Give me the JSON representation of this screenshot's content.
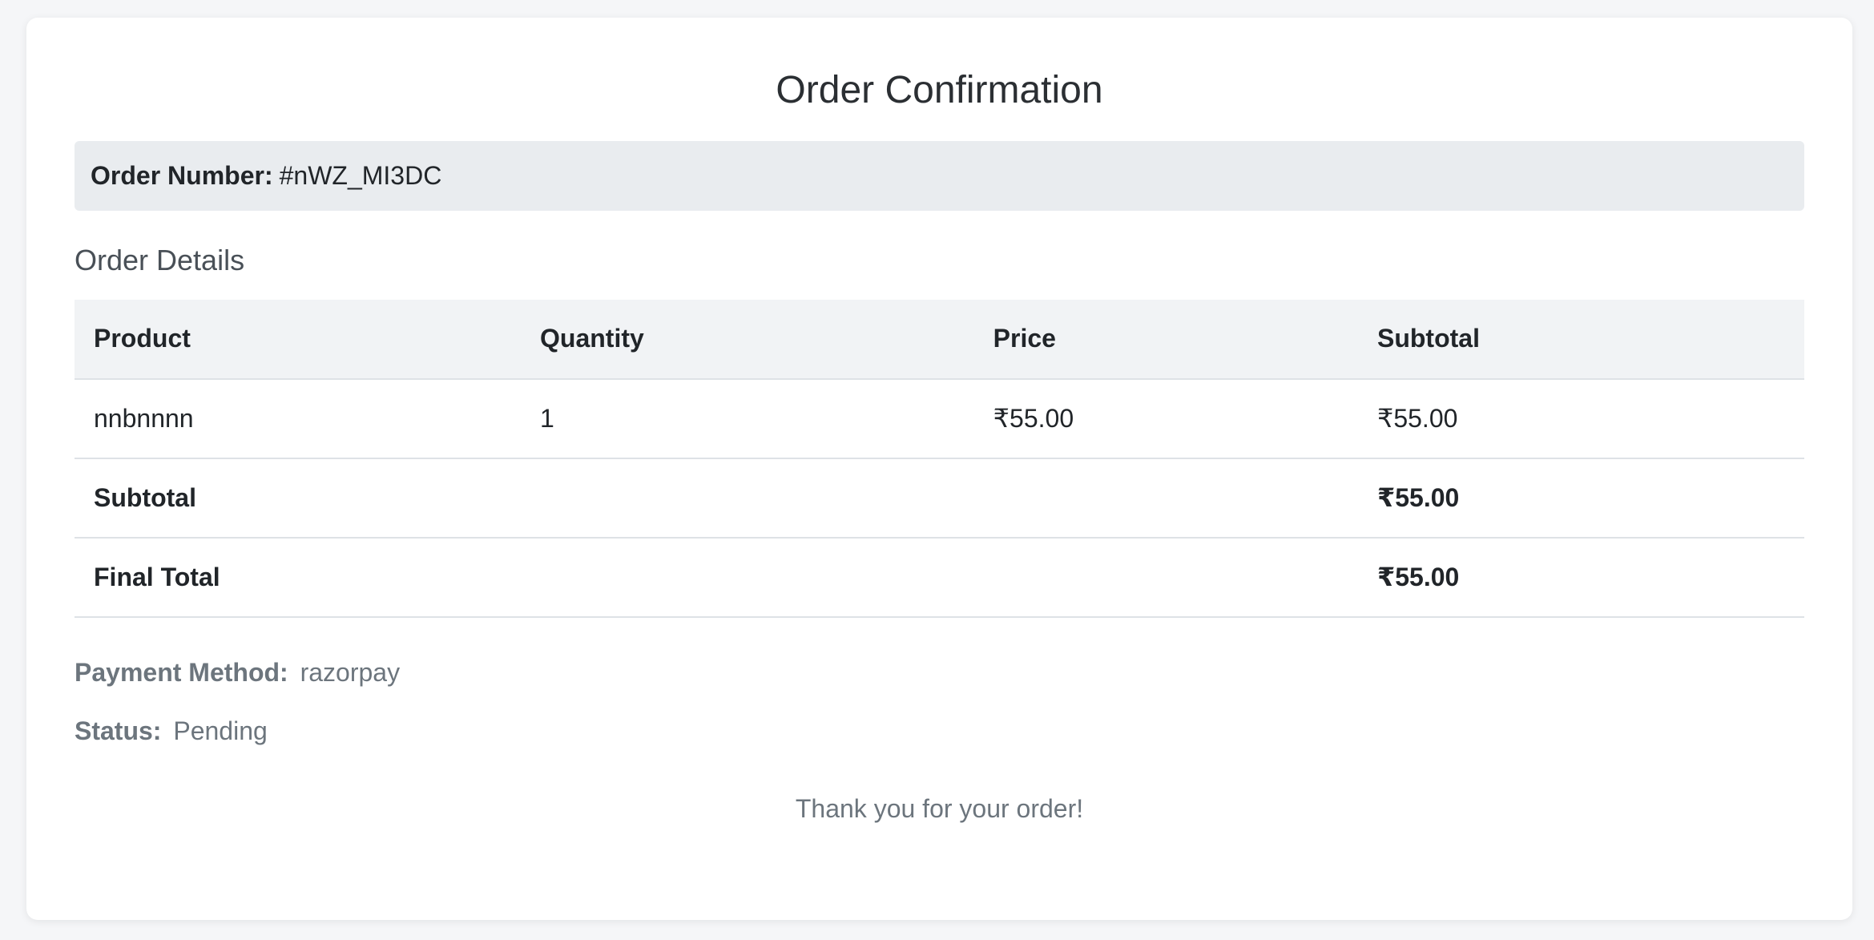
{
  "page": {
    "title": "Order Confirmation"
  },
  "order": {
    "number_label": "Order Number:",
    "number_value": "#nWZ_MI3DC"
  },
  "details": {
    "section_title": "Order Details",
    "columns": [
      "Product",
      "Quantity",
      "Price",
      "Subtotal"
    ],
    "items": [
      {
        "product": "nnbnnnn",
        "quantity": "1",
        "price": "₹55.00",
        "subtotal": "₹55.00"
      }
    ],
    "subtotal_label": "Subtotal",
    "subtotal_value": "₹55.00",
    "final_total_label": "Final Total",
    "final_total_value": "₹55.00"
  },
  "payment": {
    "method_label": "Payment Method:",
    "method_value": "razorpay",
    "status_label": "Status:",
    "status_value": "Pending"
  },
  "footer": {
    "thanks": "Thank you for your order!"
  },
  "colors": {
    "background": "#f5f6f8",
    "card": "#ffffff",
    "order_number_bg": "#e9ecef",
    "table_header_bg": "#f1f3f5",
    "muted_text": "#6c757d"
  }
}
